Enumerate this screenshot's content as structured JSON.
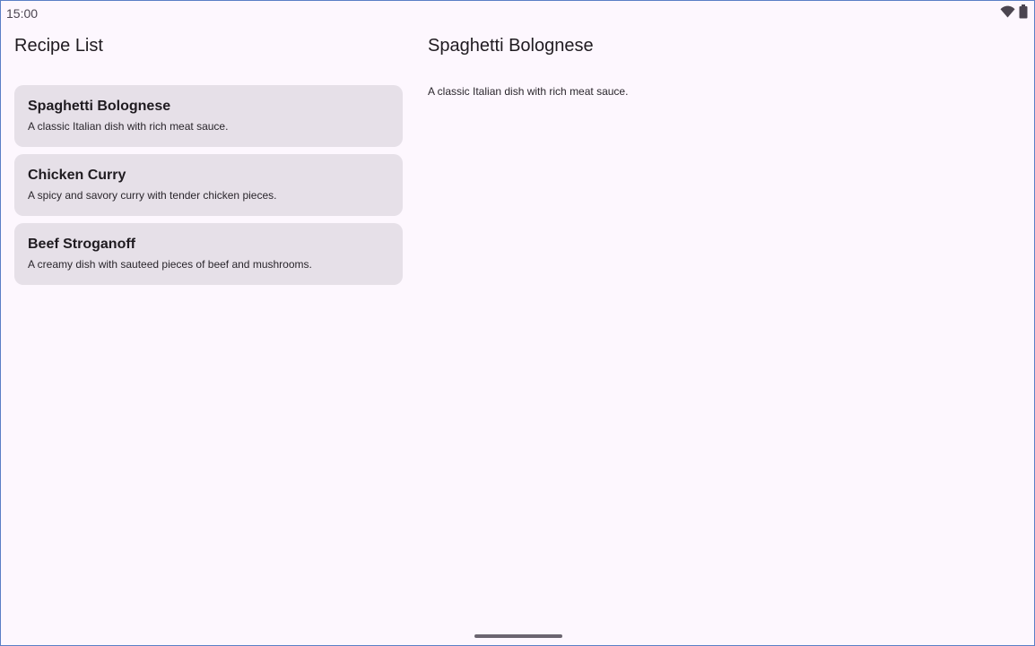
{
  "status_bar": {
    "time": "15:00",
    "icons": [
      "wifi-icon",
      "battery-icon"
    ]
  },
  "list_pane": {
    "title": "Recipe List",
    "recipes": [
      {
        "name": "Spaghetti Bolognese",
        "description": "A classic Italian dish with rich meat sauce."
      },
      {
        "name": "Chicken Curry",
        "description": "A spicy and savory curry with tender chicken pieces."
      },
      {
        "name": "Beef Stroganoff",
        "description": "A creamy dish with sauteed pieces of beef and mushrooms."
      }
    ]
  },
  "detail_pane": {
    "title": "Spaghetti Bolognese",
    "description": "A classic Italian dish with rich meat sauce."
  },
  "colors": {
    "background": "#fdf7fe",
    "card": "#e6e0e8",
    "text": "#1f1b20"
  }
}
